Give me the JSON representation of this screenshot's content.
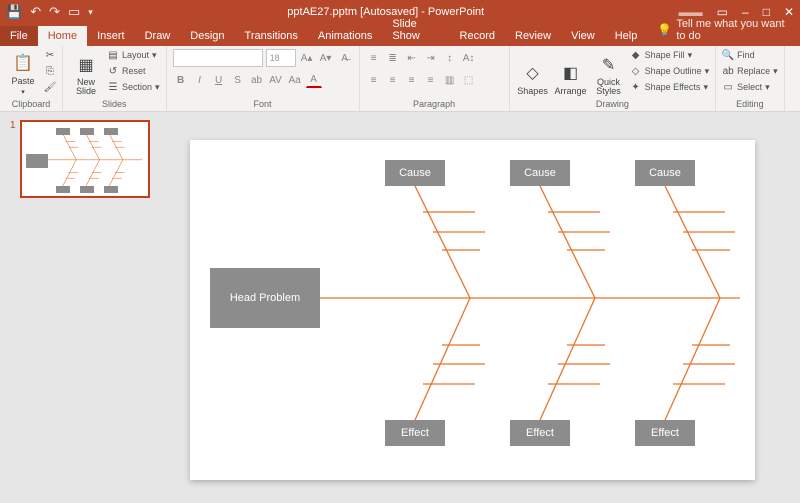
{
  "app": {
    "title": "pptAE27.pptm [Autosaved] - PowerPoint"
  },
  "tabs": {
    "file": "File",
    "home": "Home",
    "insert": "Insert",
    "draw": "Draw",
    "design": "Design",
    "transitions": "Transitions",
    "animations": "Animations",
    "slideshow": "Slide Show",
    "record": "Record",
    "review": "Review",
    "view": "View",
    "help": "Help",
    "tellme": "Tell me what you want to do"
  },
  "ribbon": {
    "clipboard": {
      "label": "Clipboard",
      "paste": "Paste"
    },
    "slides": {
      "label": "Slides",
      "newslide": "New\nSlide",
      "layout": "Layout",
      "reset": "Reset",
      "section": "Section"
    },
    "font": {
      "label": "Font",
      "size": "18"
    },
    "paragraph": {
      "label": "Paragraph"
    },
    "drawing": {
      "label": "Drawing",
      "shapes": "Shapes",
      "arrange": "Arrange",
      "quick": "Quick\nStyles",
      "fill": "Shape Fill",
      "outline": "Shape Outline",
      "effects": "Shape Effects"
    },
    "editing": {
      "label": "Editing",
      "find": "Find",
      "replace": "Replace",
      "select": "Select"
    }
  },
  "thumb": {
    "num": "1"
  },
  "diagram": {
    "head": "Head Problem",
    "cause": "Cause",
    "effect": "Effect"
  }
}
